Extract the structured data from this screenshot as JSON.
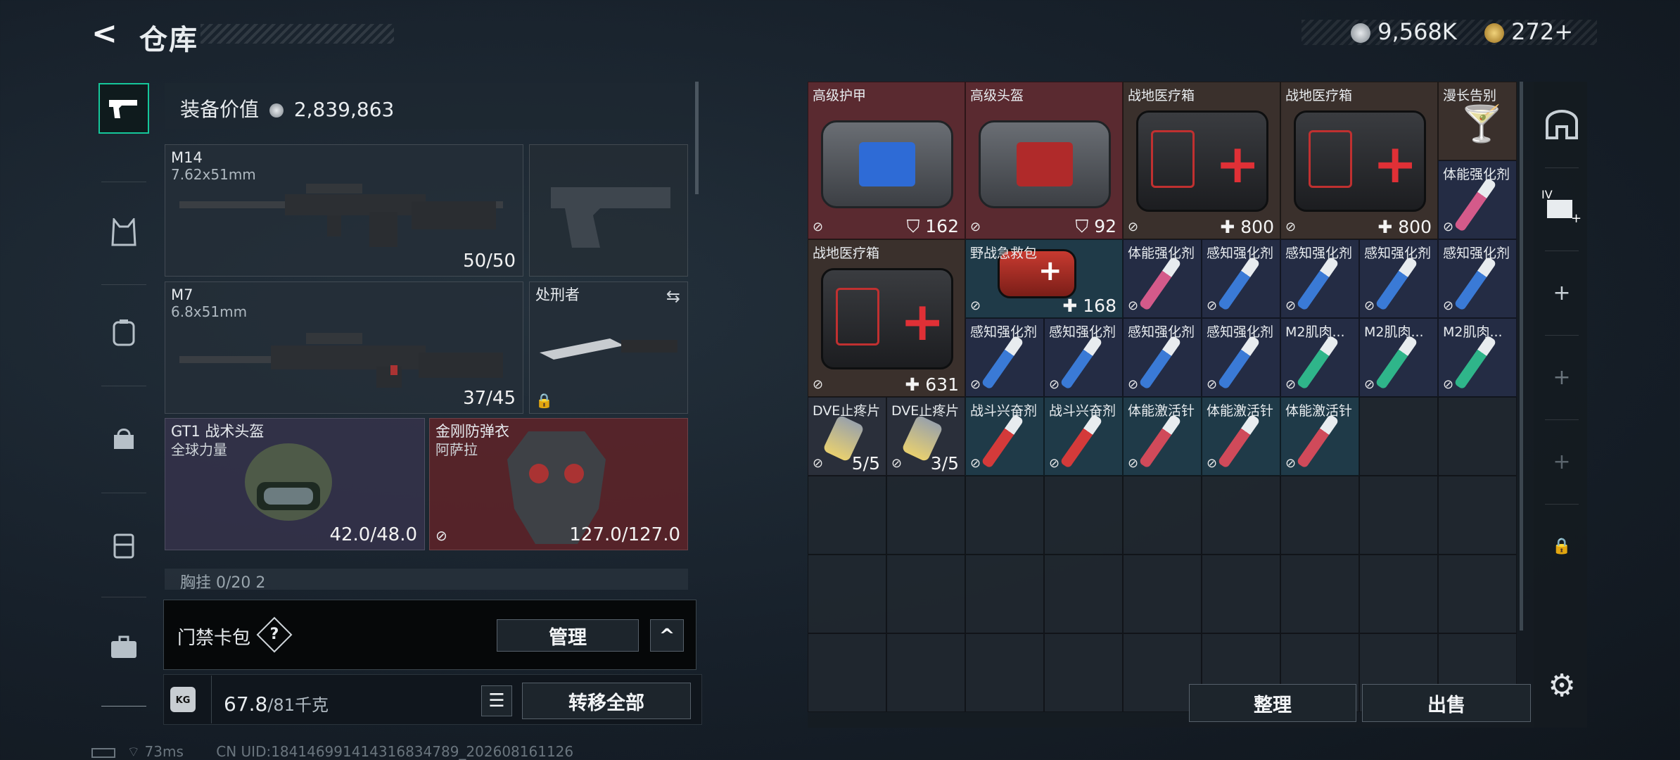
{
  "header": {
    "back_glyph": "<",
    "title": "仓库"
  },
  "currency": {
    "silver": "9,568K",
    "gold": "272",
    "gold_plus": "+",
    "silver_color": "#bfc5ca",
    "gold_color": "#d3a84a"
  },
  "tabs": [
    {
      "icon": "pistol-icon",
      "active": true
    },
    {
      "icon": "armor-vest-icon"
    },
    {
      "icon": "backpack-icon"
    },
    {
      "icon": "bag-icon"
    },
    {
      "icon": "chest-rig-icon"
    },
    {
      "icon": "briefcase-icon"
    }
  ],
  "equipment": {
    "value_label": "装备价值",
    "value": "2,839,863",
    "primary": {
      "name": "M14",
      "caliber": "7.62x51mm",
      "ammo": "50/50"
    },
    "secondary": {
      "name": "M7",
      "caliber": "6.8x51mm",
      "ammo": "37/45"
    },
    "melee": {
      "name": "处刑者"
    },
    "helmet": {
      "name": "GT1 战术头盔",
      "maker": "全球力量",
      "durability": "42.0/48.0"
    },
    "armor": {
      "name": "金刚防弹衣",
      "maker": "阿萨拉",
      "durability": "127.0/127.0"
    },
    "chest_rig": "胸挂  0/20  2"
  },
  "keycard": {
    "label": "门禁卡包",
    "help": "?",
    "manage": "管理",
    "collapse": "^"
  },
  "weight": {
    "badge": "KG",
    "current": "67.8",
    "limit": "/81千克",
    "transfer_all": "转移全部"
  },
  "status": {
    "ping": "73ms",
    "uid": "CN UID:1841469914143168347​89_202608161126"
  },
  "stash": {
    "items": [
      {
        "name": "高级护甲",
        "value": "162",
        "kind": "armor"
      },
      {
        "name": "高级头盔",
        "value": "92",
        "kind": "armor"
      },
      {
        "name": "战地医疗箱",
        "value": "800",
        "kind": "heal"
      },
      {
        "name": "战地医疗箱",
        "value": "800",
        "kind": "heal"
      },
      {
        "name": "漫长告别"
      },
      {
        "name": "体能强化剂"
      },
      {
        "name": "战地医疗箱",
        "value": "631",
        "kind": "heal"
      },
      {
        "name": "野战急救包",
        "value": "168",
        "kind": "heal"
      },
      {
        "name": "体能强化剂"
      },
      {
        "name": "感知强化剂"
      },
      {
        "name": "感知强化剂"
      },
      {
        "name": "感知强化剂"
      },
      {
        "name": "感知强化剂"
      },
      {
        "name": "感知强化剂"
      },
      {
        "name": "感知强化剂"
      },
      {
        "name": "感知强化剂"
      },
      {
        "name": "感知强化剂"
      },
      {
        "name": "M2肌肉..."
      },
      {
        "name": "M2肌肉..."
      },
      {
        "name": "M2肌肉..."
      },
      {
        "name": "DVE止疼片",
        "value": "5/5"
      },
      {
        "name": "DVE止疼片",
        "value": "3/5"
      },
      {
        "name": "战斗兴奋剂"
      },
      {
        "name": "战斗兴奋剂"
      },
      {
        "name": "体能激活针"
      },
      {
        "name": "体能激活针"
      },
      {
        "name": "体能激活针"
      }
    ],
    "sort": "整理",
    "sell": "出售"
  },
  "right_column": [
    "safe-box-icon",
    "card-pack-iv-icon",
    "plus-icon",
    "plus-icon",
    "plus-icon",
    "lock-icon",
    "settings-gear-icon"
  ]
}
